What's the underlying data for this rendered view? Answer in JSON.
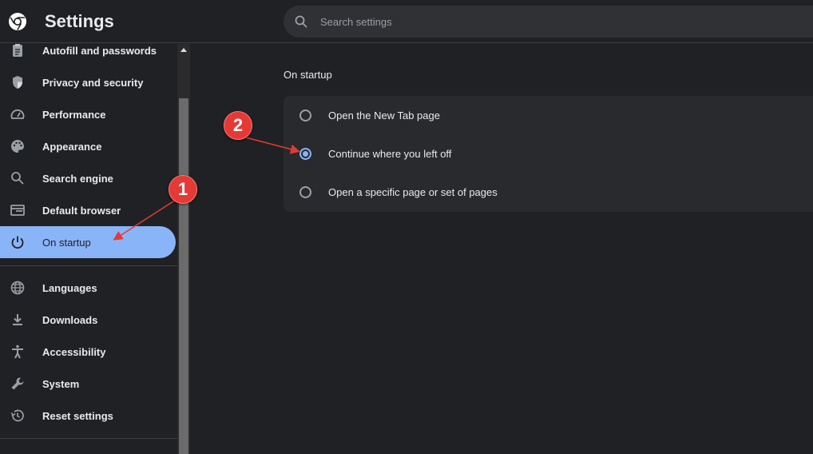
{
  "header": {
    "title": "Settings",
    "search_placeholder": "Search settings"
  },
  "sidebar": {
    "items": [
      {
        "label": "Autofill and passwords",
        "icon": "clipboard-icon"
      },
      {
        "label": "Privacy and security",
        "icon": "shield-icon"
      },
      {
        "label": "Performance",
        "icon": "speedometer-icon"
      },
      {
        "label": "Appearance",
        "icon": "palette-icon"
      },
      {
        "label": "Search engine",
        "icon": "search-icon"
      },
      {
        "label": "Default browser",
        "icon": "browser-icon"
      },
      {
        "label": "On startup",
        "icon": "power-icon",
        "active": true
      },
      {
        "label": "Languages",
        "icon": "globe-icon"
      },
      {
        "label": "Downloads",
        "icon": "download-icon"
      },
      {
        "label": "Accessibility",
        "icon": "accessibility-icon"
      },
      {
        "label": "System",
        "icon": "wrench-icon"
      },
      {
        "label": "Reset settings",
        "icon": "history-icon"
      }
    ]
  },
  "main": {
    "section_title": "On startup",
    "options": [
      {
        "label": "Open the New Tab page",
        "selected": false
      },
      {
        "label": "Continue where you left off",
        "selected": true
      },
      {
        "label": "Open a specific page or set of pages",
        "selected": false
      }
    ]
  },
  "annotations": {
    "step1": "1",
    "step2": "2",
    "color": "#e53935"
  }
}
